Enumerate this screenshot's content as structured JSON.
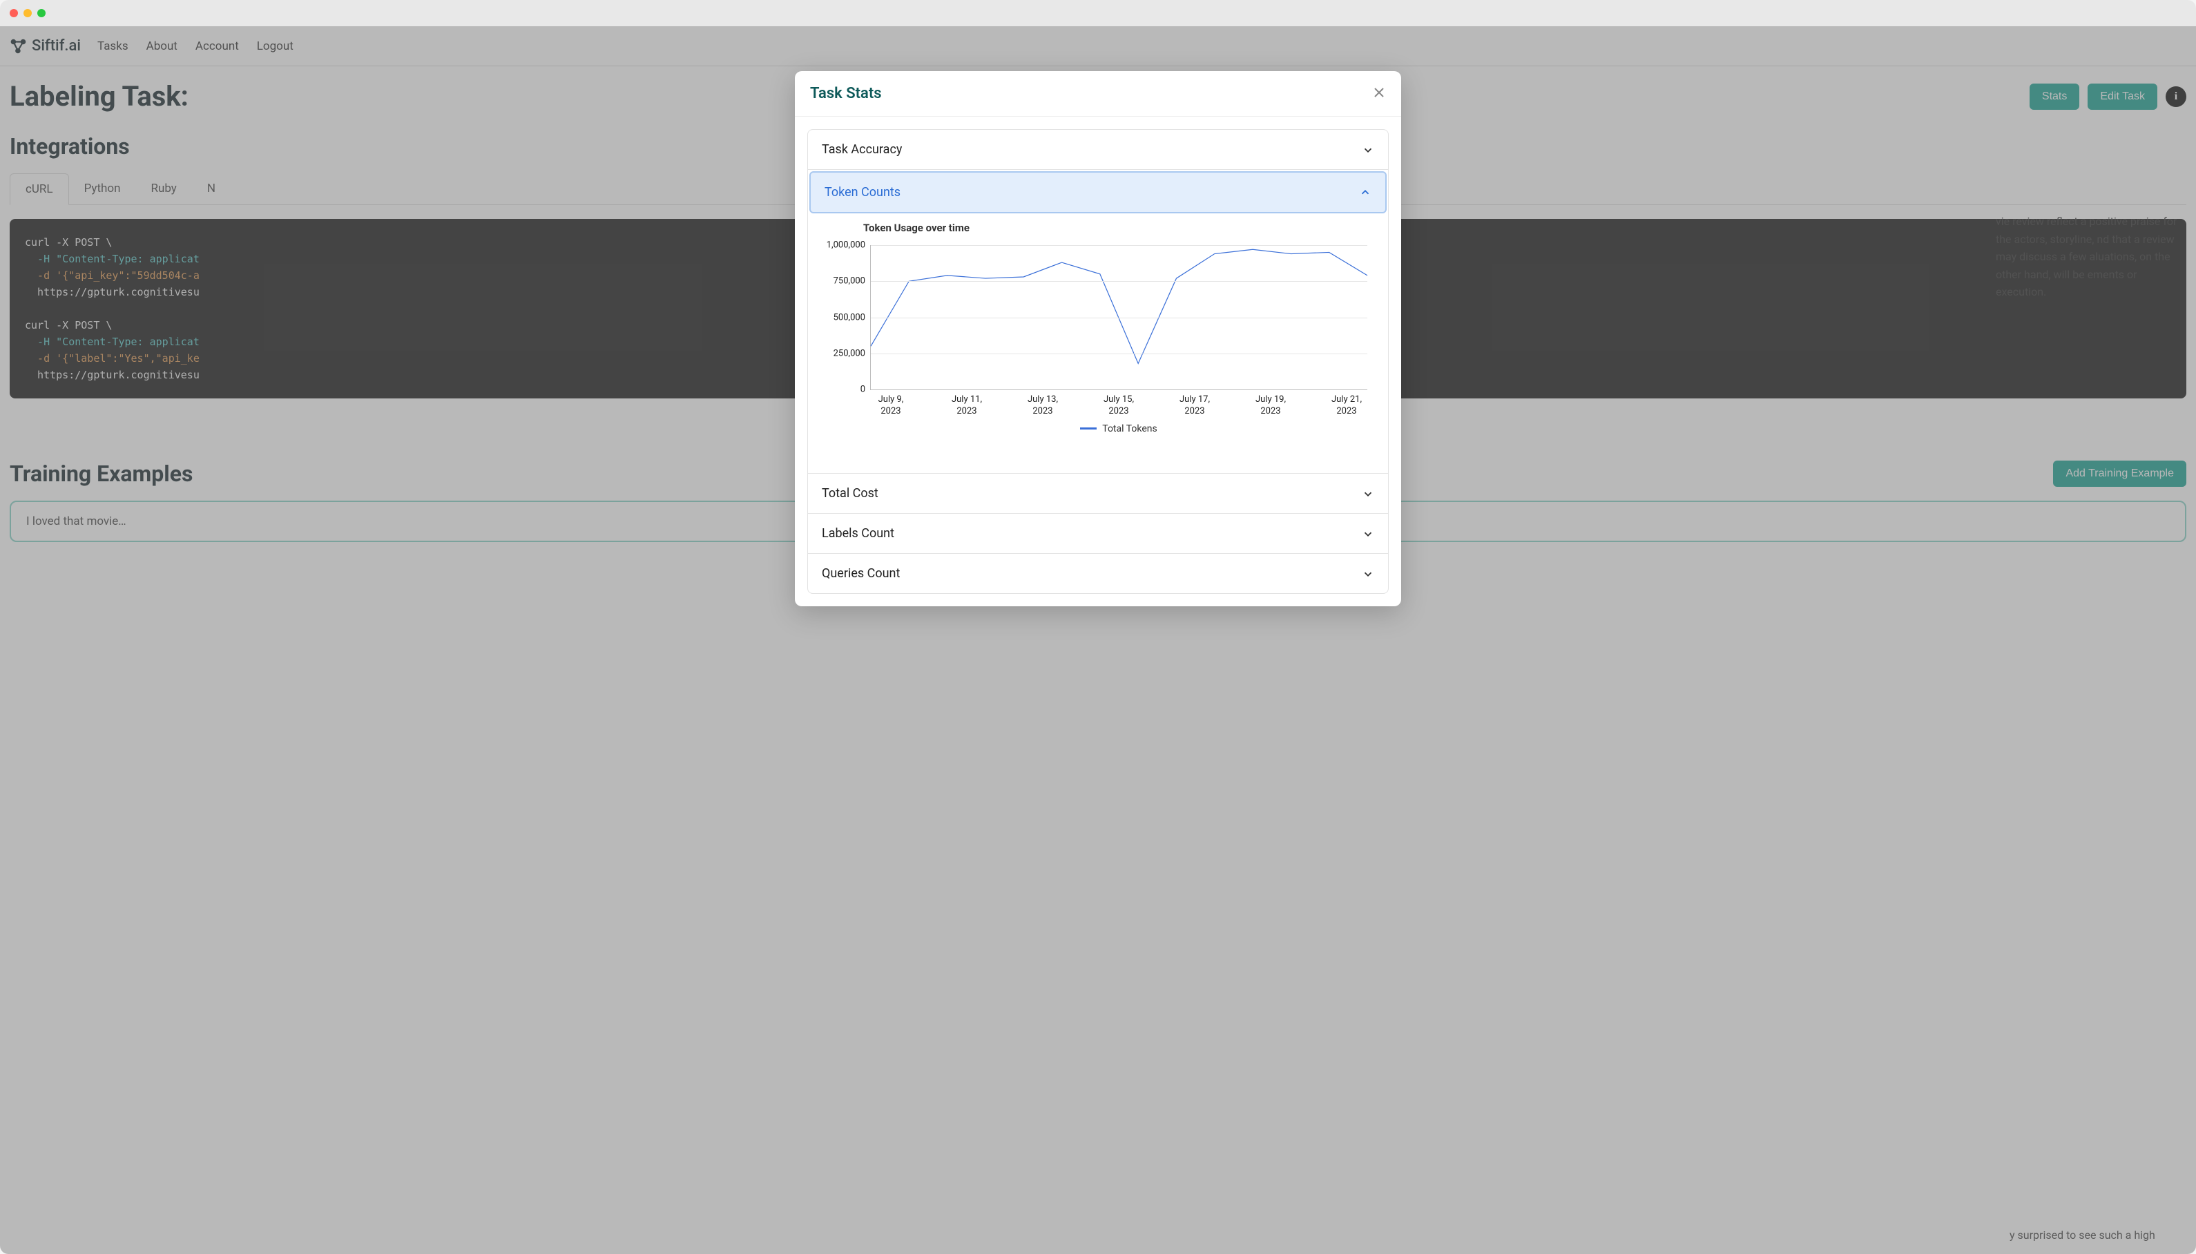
{
  "nav": {
    "brand": "Siftif.ai",
    "links": [
      "Tasks",
      "About",
      "Account",
      "Logout"
    ]
  },
  "page": {
    "title": "Labeling Task:",
    "stats_btn": "Stats",
    "edit_btn": "Edit Task",
    "integrations_heading": "Integrations",
    "tabs": [
      "cURL",
      "Python",
      "Ruby",
      "N"
    ],
    "code_lines": [
      {
        "cls": "s-white",
        "text": "curl -X POST \\"
      },
      {
        "cls": "s-cyan",
        "text": "  -H \"Content-Type: applicat"
      },
      {
        "cls": "s-orange",
        "text": "  -d '{\"api_key\":\"59dd504c-a"
      },
      {
        "cls": "s-white",
        "text": "  https://gpturk.cognitivesu"
      },
      {
        "cls": "s-white",
        "text": ""
      },
      {
        "cls": "s-white",
        "text": "curl -X POST \\"
      },
      {
        "cls": "s-cyan",
        "text": "  -H \"Content-Type: applicat"
      },
      {
        "cls": "s-orange",
        "text": "  -d '{\"label\":\"Yes\",\"api_ke"
      },
      {
        "cls": "s-white",
        "text": "  https://gpturk.cognitivesu"
      }
    ],
    "right_fragment": "vie review reflect a positive praise for the actors, storyline, nd that a review may discuss a few aluations, on the other hand, will be ements or execution.",
    "training_heading": "Training Examples",
    "add_example_btn": "Add Training Example",
    "example_card": "I loved that movie…",
    "example_right": "y surprised to see such a high"
  },
  "modal": {
    "title": "Task Stats",
    "items": [
      "Task Accuracy",
      "Token Counts",
      "Total Cost",
      "Labels Count",
      "Queries Count"
    ]
  },
  "chart_data": {
    "type": "line",
    "title": "Token Usage over time",
    "xlabel": "",
    "ylabel": "",
    "ylim": [
      0,
      1000000
    ],
    "y_ticks": [
      0,
      250000,
      500000,
      750000,
      1000000
    ],
    "y_tick_labels": [
      "0",
      "250,000",
      "500,000",
      "750,000",
      "1,000,000"
    ],
    "x_tick_labels": [
      "July 9, 2023",
      "July 11, 2023",
      "July 13, 2023",
      "July 15, 2023",
      "July 17, 2023",
      "July 19, 2023",
      "July 21, 2023"
    ],
    "series": [
      {
        "name": "Total Tokens",
        "x": [
          "July 9",
          "July 10",
          "July 11",
          "July 12",
          "July 13",
          "July 14",
          "July 15",
          "July 16",
          "July 17",
          "July 18",
          "July 19",
          "July 20",
          "July 21",
          "July 22"
        ],
        "values": [
          300000,
          750000,
          790000,
          770000,
          780000,
          880000,
          800000,
          180000,
          770000,
          940000,
          970000,
          940000,
          950000,
          790000
        ]
      }
    ],
    "legend": "Total Tokens"
  }
}
